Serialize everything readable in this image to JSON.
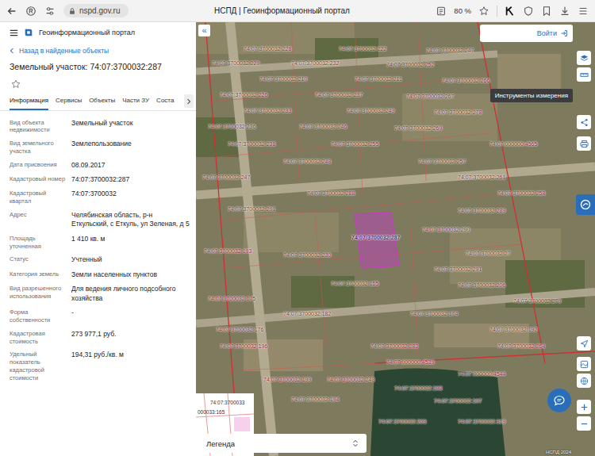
{
  "browser": {
    "url": "nspd.gov.ru",
    "title": "НСПД | Геоинформационный портал",
    "zoom": "80 %"
  },
  "app": {
    "title": "Геоинформационный портал"
  },
  "back_link": "Назад в найденные объекты",
  "object_title": "Земельный участок: 74:07:3700032:287",
  "favorite": false,
  "tabs": [
    {
      "label": "Информация",
      "selected": true
    },
    {
      "label": "Сервисы",
      "selected": false
    },
    {
      "label": "Объекты",
      "selected": false
    },
    {
      "label": "Части ЗУ",
      "selected": false
    },
    {
      "label": "Соста",
      "selected": false
    }
  ],
  "info_rows": [
    {
      "label": "Вид объекта недвижимости",
      "value": "Земельный участок"
    },
    {
      "label": "Вид земельного участка",
      "value": "Землепользование"
    },
    {
      "label": "Дата присвоения",
      "value": "08.09.2017"
    },
    {
      "label": "Кадастровый номер",
      "value": "74:07:3700032:287"
    },
    {
      "label": "Кадастровый квартал",
      "value": "74:07:3700032"
    },
    {
      "label": "Адрес",
      "value": "Челябинская область, р-н Еткульский, с Еткуль, ул Зеленая, д 5"
    },
    {
      "label": "Площадь уточненная",
      "value": "1 410 кв. м"
    },
    {
      "label": "Статус",
      "value": "Учтенный"
    },
    {
      "label": "Категория земель",
      "value": "Земли населенных пунктов"
    },
    {
      "label": "Вид разрешенного использования",
      "value": "Для ведения личного подсобного хозяйства"
    },
    {
      "label": "Форма собственности",
      "value": "-"
    },
    {
      "label": "Кадастровая стоимость",
      "value": "273 977,1 руб."
    },
    {
      "label": "Удельный показатель кадастровой стоимости",
      "value": "194,31 руб./кв. м"
    }
  ],
  "map": {
    "collapse_icon": "«",
    "login_button": "Войти",
    "tooltip": "Инструменты измерения",
    "legend": "Легенда",
    "attribution": "НСПД 2024",
    "inset_labels": [
      "74:07:3700033",
      "000033:165"
    ],
    "parcel_labels": [
      {
        "text": "74:07:3700032:228",
        "selected": false
      },
      {
        "text": "74:07:3700032:222",
        "selected": false
      },
      {
        "text": "74:07:3700032:247",
        "selected": false
      },
      {
        "text": "74:07:3700032:229",
        "selected": false
      },
      {
        "text": "74:07:3700032:232",
        "selected": false
      },
      {
        "text": "74:07:3700032:252",
        "selected": false
      },
      {
        "text": "74:07:3700032:210",
        "selected": false
      },
      {
        "text": "74:07:3700032:211",
        "selected": false
      },
      {
        "text": "74:07:3700032:266",
        "selected": false
      },
      {
        "text": "74:07:3700032:226",
        "selected": false
      },
      {
        "text": "74:07:3700032:237",
        "selected": false
      },
      {
        "text": "74:07:3700032:267",
        "selected": false
      },
      {
        "text": "74:07:3700032:233",
        "selected": false
      },
      {
        "text": "74:07:3700032:249",
        "selected": false
      },
      {
        "text": "74:07:3700032:278",
        "selected": false
      },
      {
        "text": "74:07:3700032:236",
        "selected": false
      },
      {
        "text": "74:07:3700032:246",
        "selected": false
      },
      {
        "text": "74:07:3700032:269",
        "selected": false
      },
      {
        "text": "74:07:3700032:238",
        "selected": false
      },
      {
        "text": "74:07:3700032:255",
        "selected": false
      },
      {
        "text": "74:07:000000:4565",
        "selected": false
      },
      {
        "text": "74:07:3700032:248",
        "selected": false
      },
      {
        "text": "74:07:3700032:257",
        "selected": false
      },
      {
        "text": "74:07:3700032:247",
        "selected": false
      },
      {
        "text": "74:07:3700032:261",
        "selected": false
      },
      {
        "text": "74:07:3700032:288",
        "selected": false
      },
      {
        "text": "74:07:3700032:258",
        "selected": false
      },
      {
        "text": "74:07:3700032:291",
        "selected": false
      },
      {
        "text": "74:07:3700032:289",
        "selected": false
      },
      {
        "text": "74:07:3700032:287",
        "selected": true
      },
      {
        "text": "74:07:3700032:290",
        "selected": false
      },
      {
        "text": "74:07:3700032:193",
        "selected": false
      },
      {
        "text": "74:07:3700032:230",
        "selected": false
      },
      {
        "text": "74:07:3700032:27",
        "selected": false
      },
      {
        "text": "74:07:3700032:291",
        "selected": false
      },
      {
        "text": "74:07:3700032:165",
        "selected": false
      },
      {
        "text": "74:07:3700032:206",
        "selected": false
      },
      {
        "text": "74:07:3700032:175",
        "selected": false
      },
      {
        "text": "74:07:3700032:279",
        "selected": false
      },
      {
        "text": "74:07:3700032:182",
        "selected": false
      },
      {
        "text": "74:07:3700032:174",
        "selected": false
      },
      {
        "text": "74:07:3700032:176",
        "selected": false
      },
      {
        "text": "74:07:3700032:192",
        "selected": false
      },
      {
        "text": "74:07:3700032:196",
        "selected": false
      },
      {
        "text": "74:07:3700032:282",
        "selected": false
      },
      {
        "text": "74:07:3700032:264",
        "selected": false
      },
      {
        "text": "74:07:000000:4539",
        "selected": false
      },
      {
        "text": "74:07:000000:4544",
        "selected": false
      },
      {
        "text": "74:07:3700032:199",
        "selected": false
      },
      {
        "text": "74:07:3700032:248",
        "selected": false
      },
      {
        "text": "74:07:3700032:198",
        "selected": false
      },
      {
        "text": "74:07:3700032:194",
        "selected": false
      },
      {
        "text": "74:07:3700032:197",
        "selected": false
      },
      {
        "text": "74:07:3700032:203",
        "selected": false
      },
      {
        "text": "74:07:3700032:319",
        "selected": false
      }
    ]
  }
}
